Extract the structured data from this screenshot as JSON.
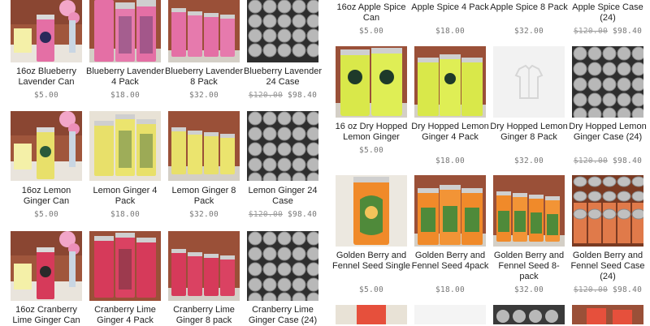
{
  "left_column": {
    "rows": [
      [
        {
          "title": "16oz Blueberry Lavender Can",
          "price": "$5.00",
          "image": "single-can-photo"
        },
        {
          "title": "Blueberry Lavender 4 Pack",
          "price": "$18.00",
          "image": "4-pack-photo"
        },
        {
          "title": "Blueberry Lavender 8 Pack",
          "price": "$32.00",
          "image": "8-pack-photo"
        },
        {
          "title": "Blueberry Lavender 24 Case",
          "price_original": "$120.00",
          "price": "$98.40",
          "image": "case-can-tops-photo"
        }
      ],
      [
        {
          "title": "16oz Lemon Ginger Can",
          "price": "$5.00",
          "image": "single-can-photo"
        },
        {
          "title": "Lemon Ginger 4 Pack",
          "price": "$18.00",
          "image": "4-pack-photo"
        },
        {
          "title": "Lemon Ginger 8 Pack",
          "price": "$32.00",
          "image": "8-pack-photo"
        },
        {
          "title": "Lemon Ginger 24 Case",
          "price_original": "$120.00",
          "price": "$98.40",
          "image": "case-can-tops-photo"
        }
      ],
      [
        {
          "title": "16oz Cranberry Lime Ginger Can",
          "price": "",
          "image": "single-can-photo"
        },
        {
          "title": "Cranberry Lime Ginger 4 Pack",
          "price": "",
          "image": "4-pack-photo"
        },
        {
          "title": "Cranberry Lime Ginger 8 pack",
          "price": "",
          "image": "8-pack-photo"
        },
        {
          "title": "Cranberry Lime Ginger Case (24)",
          "price": "",
          "image": "case-can-tops-photo"
        }
      ]
    ]
  },
  "right_column": {
    "rows": [
      [
        {
          "title": "16oz Apple Spice Can",
          "price": "$5.00"
        },
        {
          "title": "Apple Spice 4 Pack",
          "price": "$18.00"
        },
        {
          "title": "Apple Spice 8 Pack",
          "price": "$32.00"
        },
        {
          "title": "Apple Spice Case (24)",
          "price_original": "$120.00",
          "price": "$98.40"
        }
      ],
      [
        {
          "title": "16 oz Dry Hopped Lemon Ginger",
          "price": "$5.00",
          "image": "single-can-photo"
        },
        {
          "title": "Dry Hopped Lemon Ginger 4 Pack",
          "price": "$18.00",
          "image": "4-pack-photo"
        },
        {
          "title": "Dry Hopped Lemon Ginger 8 Pack",
          "price": "$32.00",
          "image": "placeholder-shirt-icon"
        },
        {
          "title": "Dry Hopped Lemon Ginger Case (24)",
          "price_original": "$120.00",
          "price": "$98.40",
          "image": "case-can-tops-photo"
        }
      ],
      [
        {
          "title": "Golden Berry and Fennel Seed Single",
          "price": "$5.00",
          "image": "single-can-photo"
        },
        {
          "title": "Golden Berry and Fennel Seed 4pack",
          "price": "$18.00",
          "image": "4-pack-photo"
        },
        {
          "title": "Golden Berry and Fennel Seed 8-pack",
          "price": "$32.00",
          "image": "8-pack-photo"
        },
        {
          "title": "Golden Berry and Fennel Seed Case (24)",
          "price_original": "$120.00",
          "price": "$98.40",
          "image": "case-can-tops-photo"
        }
      ],
      [
        {
          "image": "single-can-photo"
        },
        {
          "image": "blank-photo"
        },
        {
          "image": "8-pack-photo"
        },
        {
          "image": "case-can-tops-photo"
        }
      ]
    ]
  },
  "colors": {
    "title_text": "#222222",
    "price_text": "#777777",
    "strike_text": "#999999",
    "blueberry_can": "#e46fa5",
    "lemon_can": "#e8e06a",
    "cranberry_can": "#d63a5a",
    "dry_hopped_can": "#d9e84a",
    "golden_can": "#f08a2a",
    "apple_can": "#e6503c",
    "brick": "#a0563c",
    "can_top_silver": "#b8b8b8"
  }
}
